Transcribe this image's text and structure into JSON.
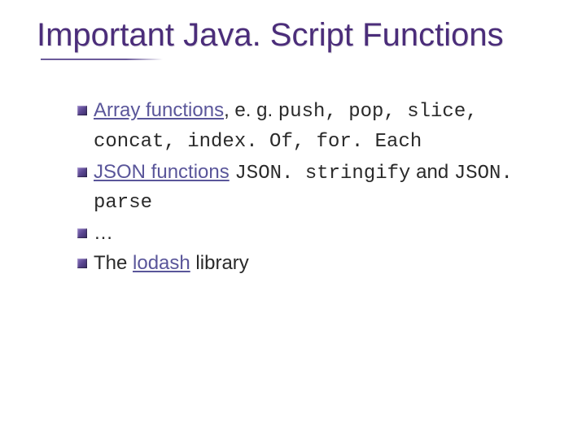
{
  "title": "Important Java. Script Functions",
  "bullets": [
    {
      "link": "Array functions",
      "sep": ", e. g. ",
      "code": "push, pop, slice, concat, index. Of, for. Each"
    },
    {
      "link": "JSON functions",
      "code1": "JSON. stringify",
      "mid": " and ",
      "code2": "JSON. parse"
    },
    {
      "plain": "…"
    },
    {
      "pre": "The ",
      "link": "lodash",
      "post": " library"
    }
  ]
}
